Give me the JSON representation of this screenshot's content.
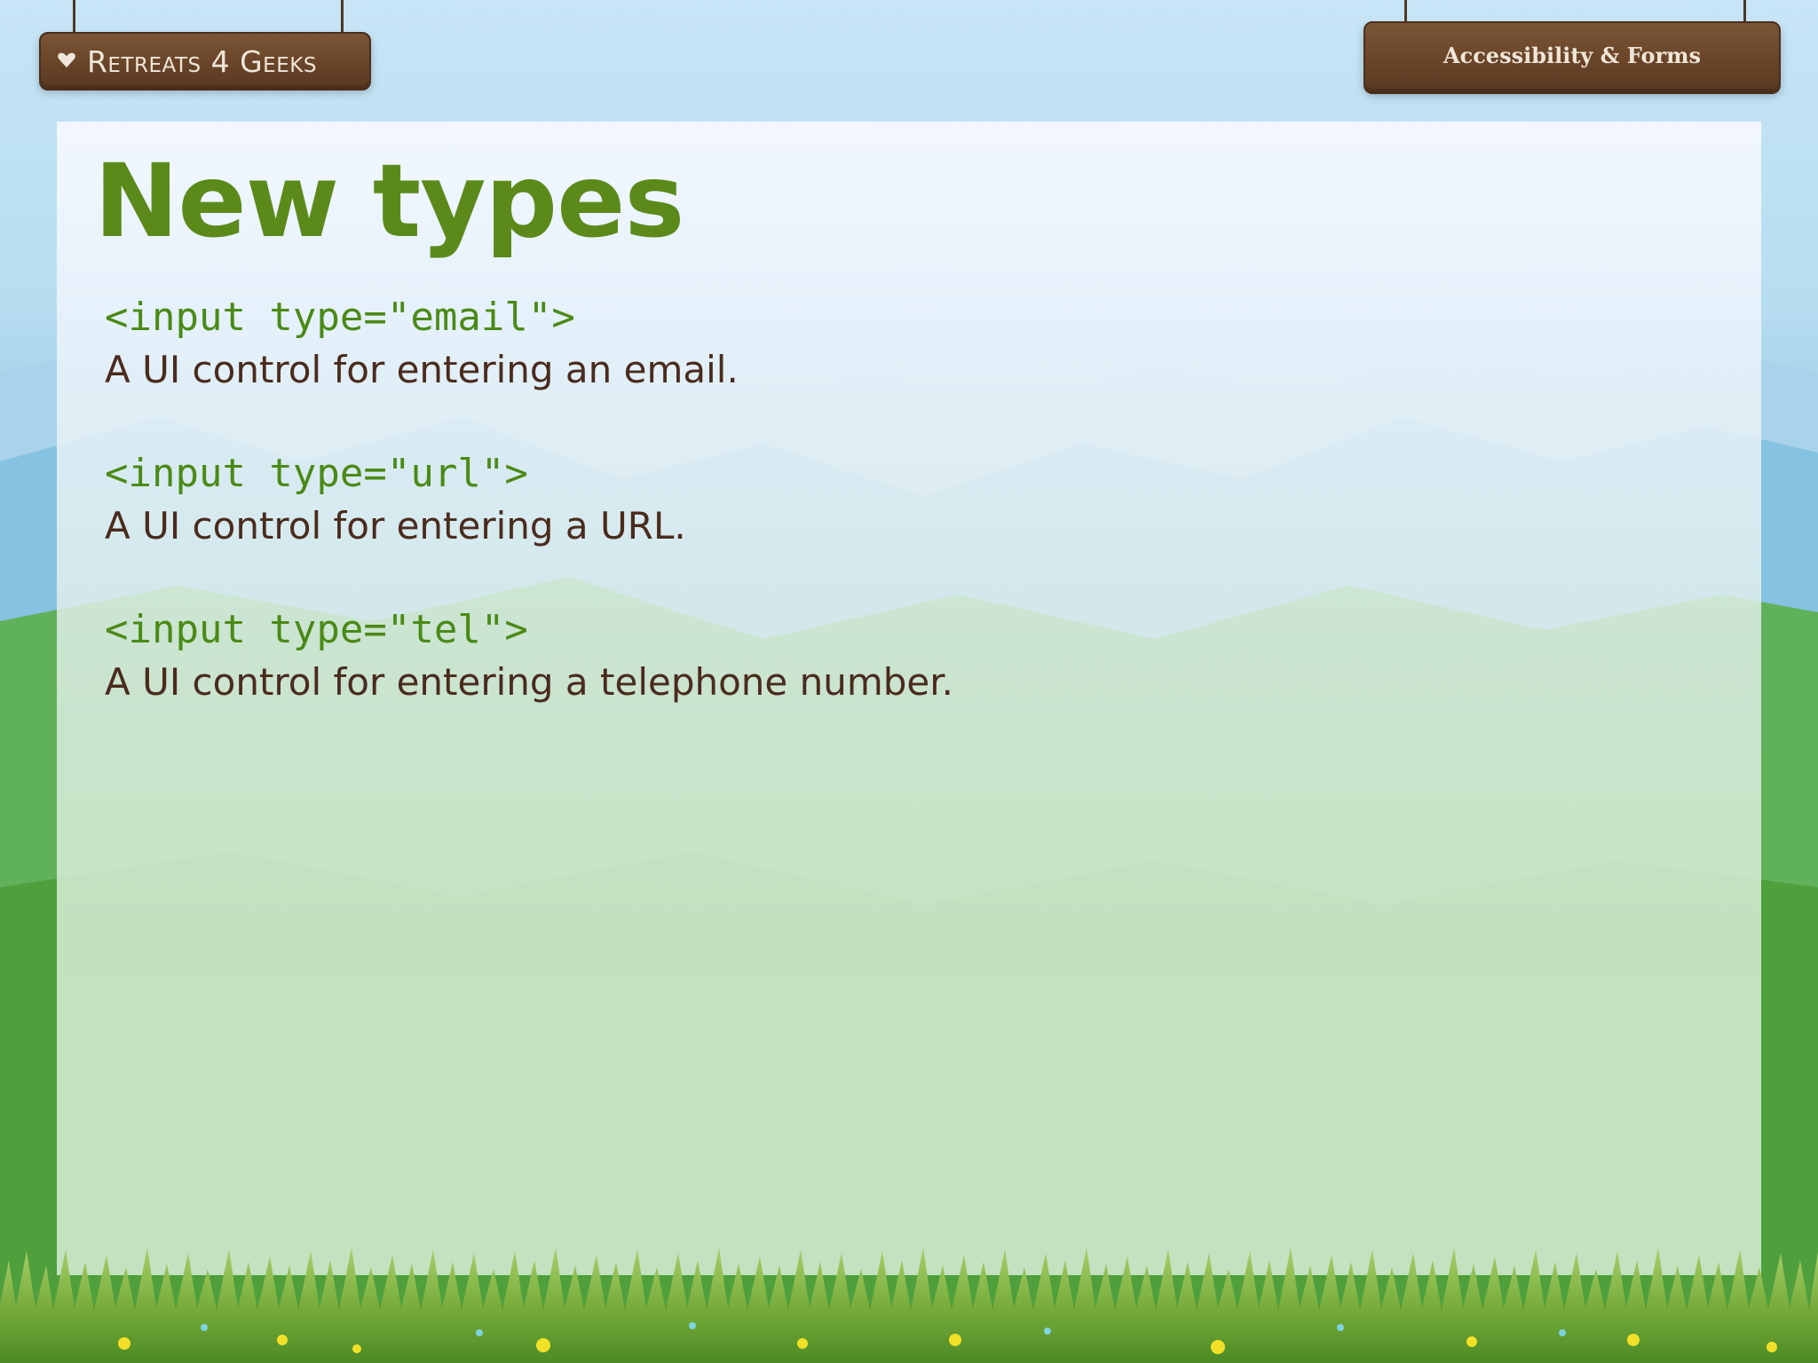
{
  "header": {
    "brand": "Retreats 4 Geeks",
    "section": "Accessibility & Forms"
  },
  "slide": {
    "title": "New types",
    "items": [
      {
        "code": "<input type=\"email\">",
        "description": "A UI control for entering an email."
      },
      {
        "code": "<input type=\"url\">",
        "description": "A UI control for entering a URL."
      },
      {
        "code": "<input type=\"tel\">",
        "description": "A UI control for entering a telephone number."
      }
    ]
  },
  "colors": {
    "title": "#5b8a1b",
    "code": "#4a8a16",
    "description": "#4a2b1d",
    "signboard": "#6a4529",
    "sky": "#c7e5f6",
    "meadow": "#56a84a"
  },
  "icons": [
    "heart-icon"
  ]
}
